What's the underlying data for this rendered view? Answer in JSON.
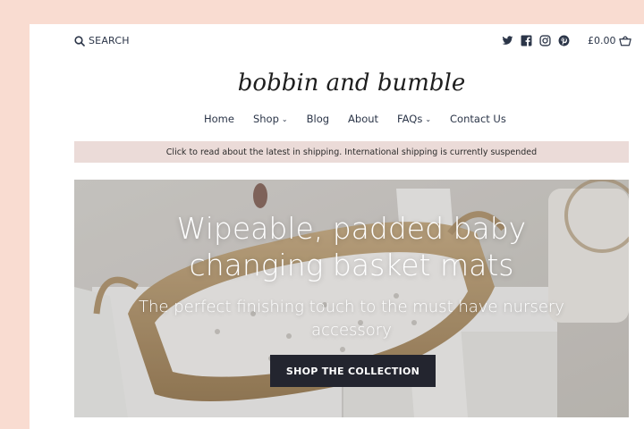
{
  "header": {
    "search_label": "SEARCH",
    "cart_total": "£0.00",
    "socials": [
      "twitter-icon",
      "facebook-icon",
      "instagram-icon",
      "pinterest-icon"
    ],
    "logo_text": "bobbin and bumble"
  },
  "nav": {
    "items": [
      {
        "label": "Home"
      },
      {
        "label": "Shop",
        "has_dropdown": true
      },
      {
        "label": "Blog"
      },
      {
        "label": "About"
      },
      {
        "label": "FAQs",
        "has_dropdown": true
      },
      {
        "label": "Contact Us"
      }
    ]
  },
  "notice": {
    "text": "Click to read about the latest in shipping. International shipping is currently suspended"
  },
  "hero": {
    "title": "Wipeable, padded baby changing basket mats",
    "subtitle": "The perfect finishing touch to the must have nursery accessory",
    "cta_label": "SHOP THE COLLECTION"
  },
  "colors": {
    "background": "#f9dcd1",
    "text": "#2b3548",
    "notice_bg": "#ebdbd8",
    "cta_bg": "#23252f"
  }
}
